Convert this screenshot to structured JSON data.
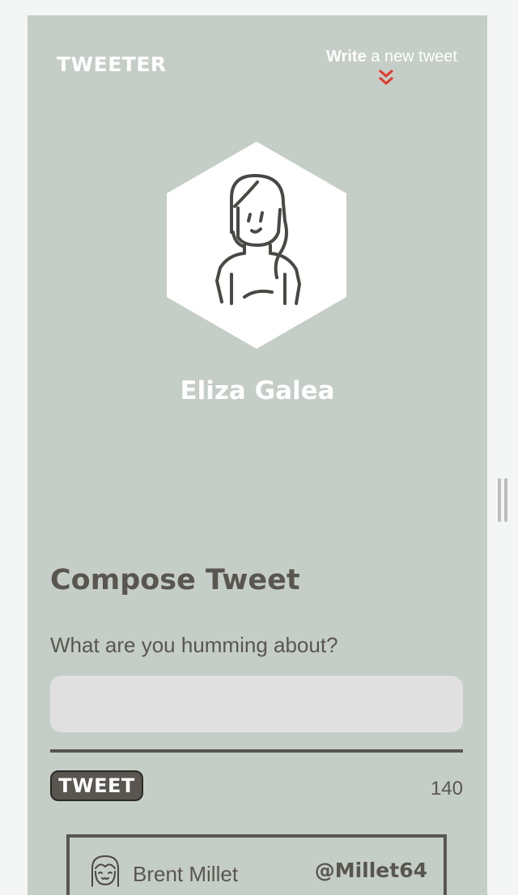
{
  "header": {
    "logo": "TWEETER",
    "write_bold": "Write",
    "write_rest": " a new tweet",
    "chevron_icon": "double-chevron-down-icon",
    "accent_color": "#e03a2e"
  },
  "profile": {
    "avatar_icon": "woman-avatar-icon",
    "name": "Eliza Galea"
  },
  "compose": {
    "title": "Compose Tweet",
    "label": "What are you humming about?",
    "input_value": "",
    "input_placeholder": "",
    "button_label": "TWEET",
    "char_count": "140"
  },
  "tweets": [
    {
      "avatar_icon": "smiling-avatar-icon",
      "name": "Brent Millet",
      "handle": "@Millet64"
    }
  ],
  "colors": {
    "panel_bg": "#c5cdc7",
    "text_dark": "#595650",
    "input_bg": "#e0e0e0",
    "white": "#ffffff"
  }
}
